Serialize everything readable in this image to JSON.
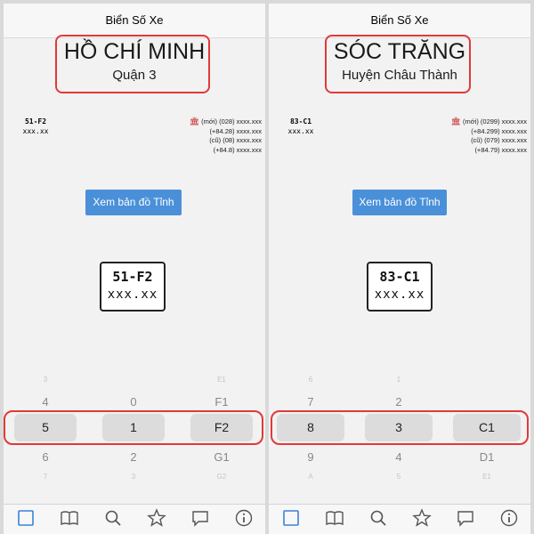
{
  "panels": [
    {
      "nav_title": "Biển Số Xe",
      "province": "HỒ CHÍ MINH",
      "district": "Quận 3",
      "small_plate": {
        "top": "51-F2",
        "bottom": "xxx.xx"
      },
      "phones": [
        "(mới) (028) xxxx.xxx",
        "(+84.28) xxxx.xxx",
        "(cũ) (08) xxxx.xxx",
        "(+84.8) xxxx.xxx"
      ],
      "map_button": "Xem bản đồ Tỉnh",
      "plate": {
        "top": "51-F2",
        "bottom": "xxx.xx"
      },
      "wheels": [
        {
          "items": [
            "3",
            "4",
            "5",
            "6",
            "7"
          ]
        },
        {
          "items": [
            "",
            "0",
            "1",
            "2",
            "3"
          ]
        },
        {
          "items": [
            "E1",
            "F1",
            "F2",
            "G1",
            "G2"
          ]
        }
      ]
    },
    {
      "nav_title": "Biển Số Xe",
      "province": "SÓC TRĂNG",
      "district": "Huyện Châu Thành",
      "small_plate": {
        "top": "83-C1",
        "bottom": "xxx.xx"
      },
      "phones": [
        "(mới) (0299) xxxx.xxx",
        "(+84.299) xxxx.xxx",
        "(cũ) (079) xxxx.xxx",
        "(+84.79) xxxx.xxx"
      ],
      "map_button": "Xem bản đồ Tỉnh",
      "plate": {
        "top": "83-C1",
        "bottom": "xxx.xx"
      },
      "wheels": [
        {
          "items": [
            "6",
            "7",
            "8",
            "9",
            "A"
          ]
        },
        {
          "items": [
            "1",
            "2",
            "3",
            "4",
            "5"
          ]
        },
        {
          "items": [
            "",
            "",
            "C1",
            "D1",
            "E1"
          ]
        }
      ]
    }
  ],
  "tabs": [
    {
      "icon": "square-icon",
      "active": true
    },
    {
      "icon": "book-icon"
    },
    {
      "icon": "search-icon"
    },
    {
      "icon": "star-icon"
    },
    {
      "icon": "chat-icon"
    },
    {
      "icon": "info-icon"
    }
  ],
  "colors": {
    "accent_blue": "#4a90d9",
    "highlight_red": "#e03a3a",
    "bank_red": "#c62828"
  }
}
